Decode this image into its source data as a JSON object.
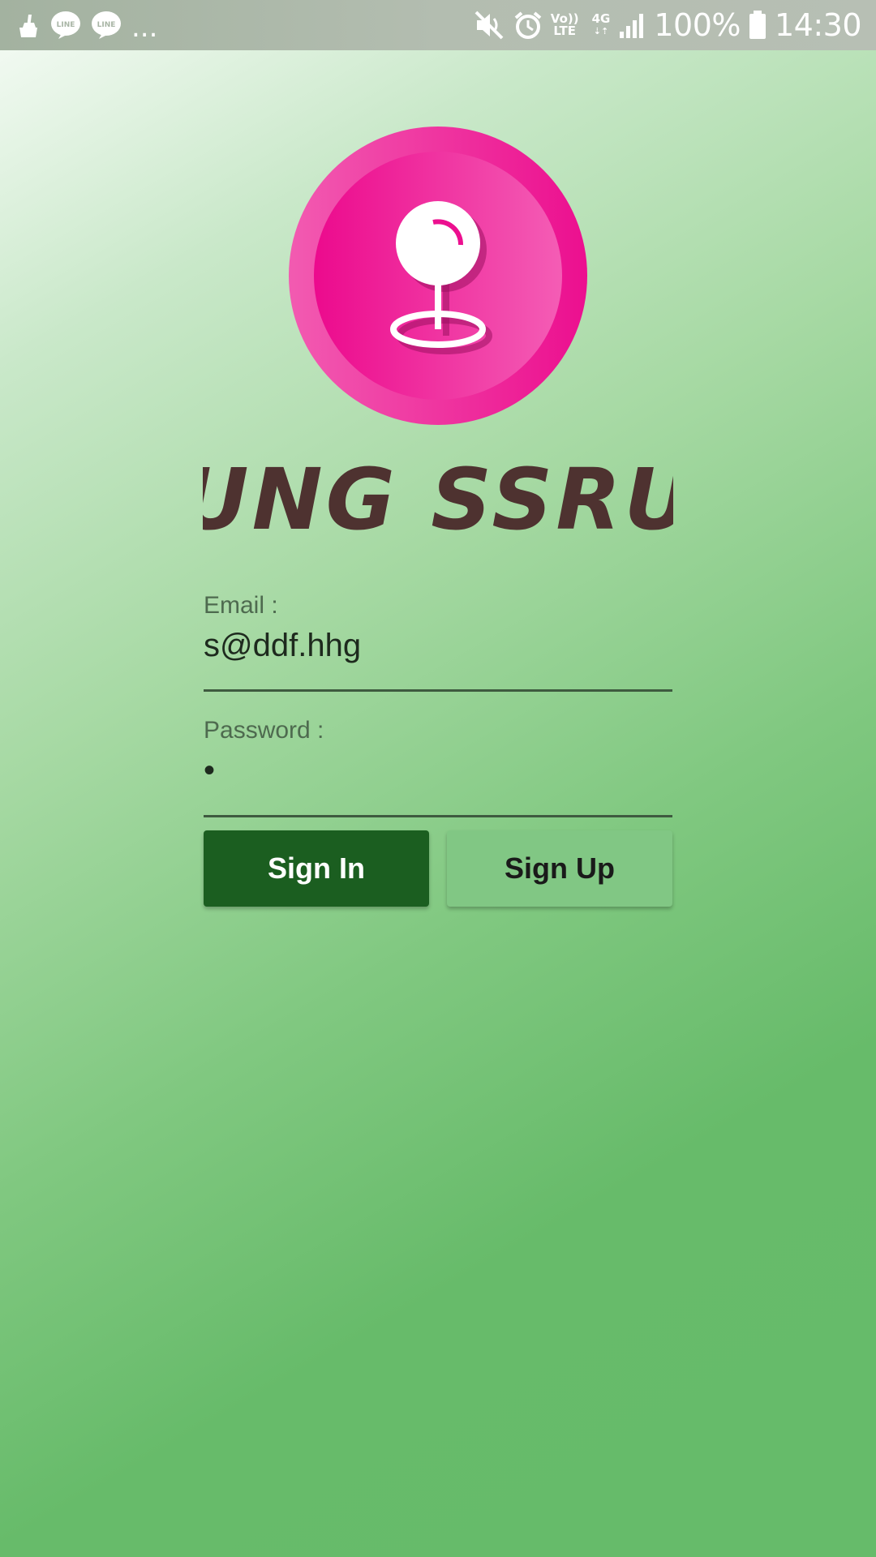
{
  "status_bar": {
    "icons_left": [
      "cleaner-icon",
      "line-app-icon",
      "line-app-icon"
    ],
    "line_label": "LINE",
    "overflow": "...",
    "icons_right": [
      "mute-icon",
      "alarm-icon",
      "volte-icon",
      "4g-icon",
      "signal-icon",
      "battery-icon"
    ],
    "volte_top": "Vo))",
    "volte_bottom": "LTE",
    "network": "4G",
    "battery": "100%",
    "time": "14:30"
  },
  "app": {
    "name": "UNG SSRU",
    "logo_icon": "location-pin-icon",
    "accent_color": "#e91e8c"
  },
  "form": {
    "email_label": "Email :",
    "email_value": "s@ddf.hhg",
    "password_label": "Password :",
    "password_value": "•",
    "signin_label": "Sign In",
    "signup_label": "Sign Up"
  }
}
